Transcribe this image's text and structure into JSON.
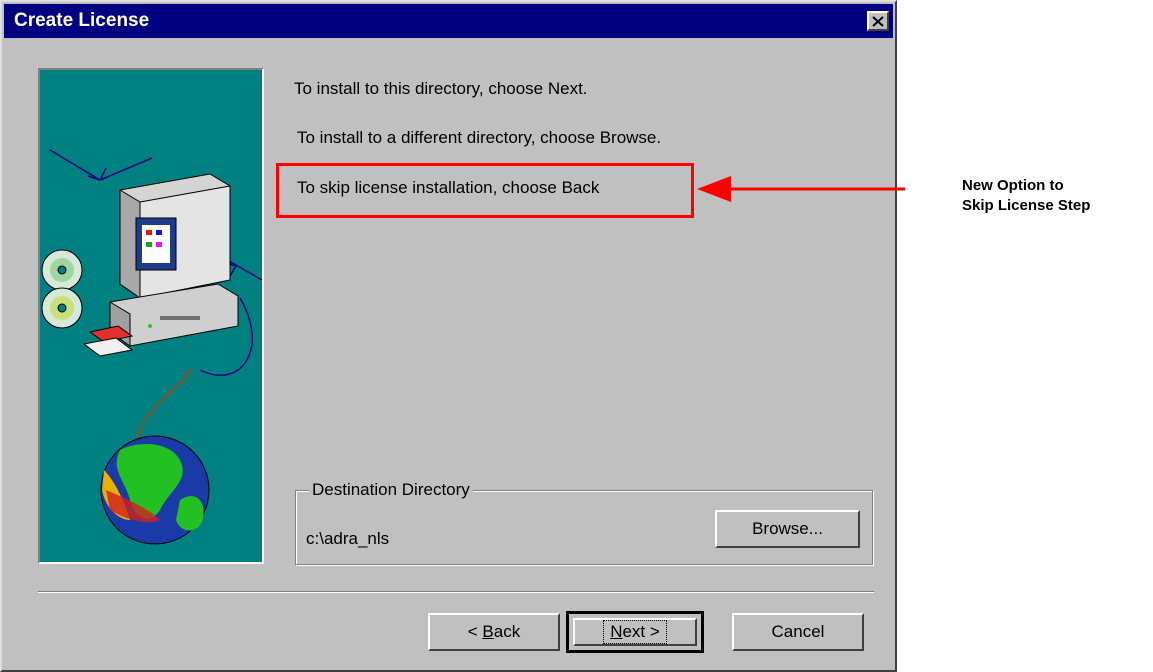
{
  "window": {
    "title": "Create License",
    "close_label": "×"
  },
  "instructions": {
    "next_text": "To install to this directory, choose Next.",
    "browse_text": "To install to a different directory, choose Browse.",
    "back_text": "To skip license installation, choose Back"
  },
  "destination": {
    "group_label": "Destination Directory",
    "path": "c:\\adra_nls",
    "browse_label": "Browse..."
  },
  "buttons": {
    "back_prefix": "< ",
    "back_key": "B",
    "back_rest": "ack",
    "next_key": "N",
    "next_rest": "ext >",
    "cancel_label": "Cancel"
  },
  "annotation": {
    "line1": "New Option to",
    "line2": "Skip License Step",
    "color": "#ff0000"
  },
  "colors": {
    "titlebar": "#000080",
    "dialog": "#c0c0c0",
    "art_background": "#008080"
  }
}
